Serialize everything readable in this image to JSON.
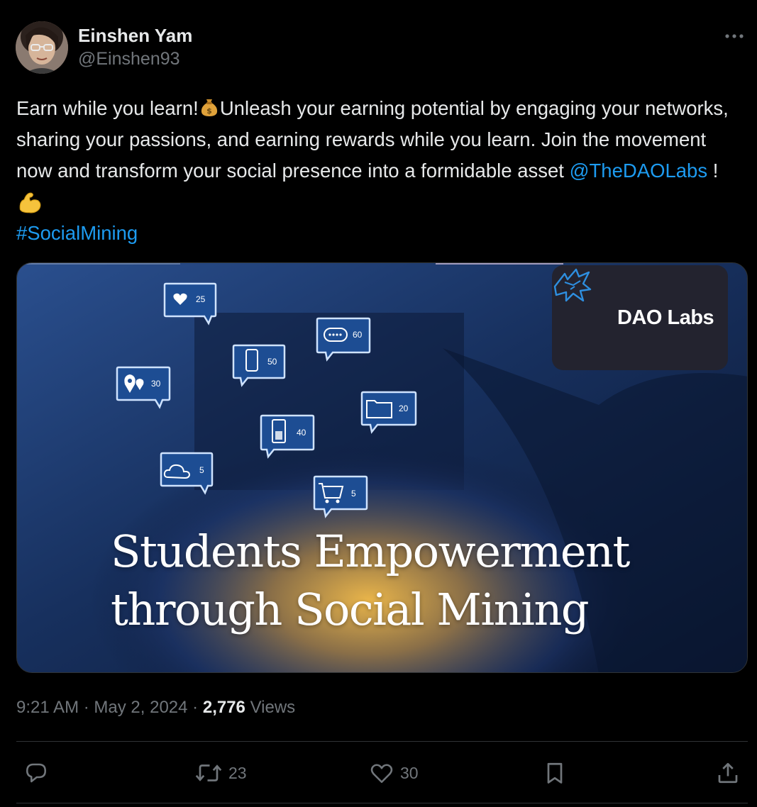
{
  "author": {
    "display_name": "Einshen Yam",
    "handle": "@Einshen93"
  },
  "tweet": {
    "text_part1": "Earn while you learn!",
    "text_part2": "Unleash your earning potential by engaging your networks, sharing your passions, and earning rewards while you learn. Join the movement now and transform your social presence into a formidable asset ",
    "mention": "@TheDAOLabs",
    "text_part3": " ! ",
    "hashtag": "#SocialMining"
  },
  "media": {
    "brand": "DAO Labs",
    "headline_line1": "Students Empowerment",
    "headline_line2": "through Social Mining",
    "bubbles": [
      {
        "icon": "heart-icon",
        "count": "25"
      },
      {
        "icon": "chat-dots-icon",
        "count": "60"
      },
      {
        "icon": "phone-icon",
        "count": "50"
      },
      {
        "icon": "location-pin-icon",
        "count": "30"
      },
      {
        "icon": "folder-icon",
        "count": "20"
      },
      {
        "icon": "document-icon",
        "count": "40"
      },
      {
        "icon": "cloud-icon",
        "count": "5"
      },
      {
        "icon": "cart-icon",
        "count": "5"
      }
    ]
  },
  "meta": {
    "time": "9:21 AM",
    "separator": "·",
    "date": "May 2, 2024",
    "views_count": "2,776",
    "views_label": "Views"
  },
  "actions": {
    "retweets": "23",
    "likes": "30"
  },
  "colors": {
    "background": "#000000",
    "text": "#e7e9ea",
    "secondary": "#71767b",
    "link": "#1d9bf0",
    "border": "#2f3336"
  }
}
